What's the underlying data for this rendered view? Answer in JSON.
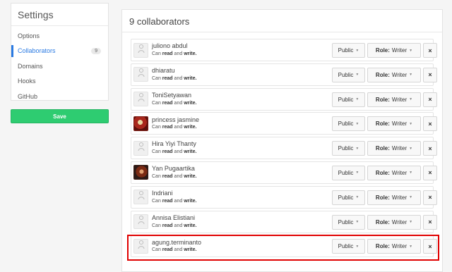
{
  "sidebar": {
    "title": "Settings",
    "items": [
      {
        "label": "Options",
        "active": false
      },
      {
        "label": "Collaborators",
        "active": true,
        "count": "9"
      },
      {
        "label": "Domains",
        "active": false
      },
      {
        "label": "Hooks",
        "active": false
      },
      {
        "label": "GitHub",
        "active": false
      }
    ]
  },
  "save_label": "Save",
  "panel": {
    "title": "9 collaborators",
    "perm_prefix": "Can",
    "perm_read": "read",
    "perm_and": "and",
    "perm_write": "write.",
    "visibility_label": "Public",
    "role_prefix": "Role:",
    "role_value": "Writer",
    "remove_label": "×"
  },
  "collaborators": [
    {
      "name": "juliono abdul",
      "avatar": "default-avatar-icon"
    },
    {
      "name": "dhiaratu",
      "avatar": "default-avatar-icon"
    },
    {
      "name": "ToniSetyawan",
      "avatar": "default-avatar-icon"
    },
    {
      "name": "princess jasmine",
      "avatar": "photo-avatar"
    },
    {
      "name": "Hira Yiyi Thanty",
      "avatar": "default-avatar-icon"
    },
    {
      "name": "Yan Pugaartika",
      "avatar": "photo-avatar"
    },
    {
      "name": "Indriani",
      "avatar": "default-avatar-icon"
    },
    {
      "name": "Annisa Elistiani",
      "avatar": "default-avatar-icon"
    },
    {
      "name": "agung.terminanto",
      "avatar": "default-avatar-icon"
    }
  ],
  "colors": {
    "accent": "#2a7ae2",
    "save": "#2ecc71",
    "highlight": "#e00000"
  }
}
